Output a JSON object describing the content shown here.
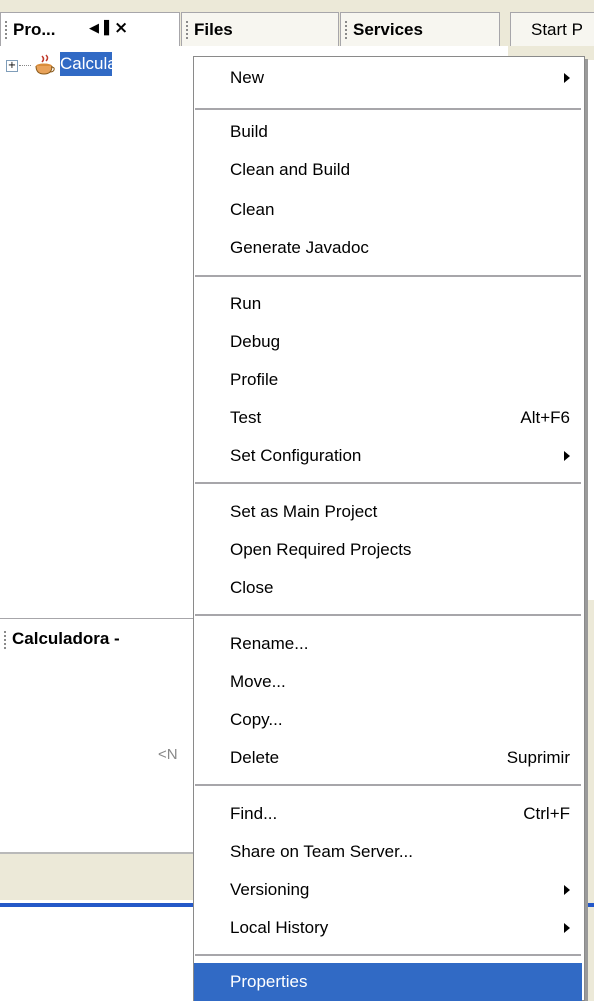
{
  "tabs": {
    "projects": "Pro...",
    "files": "Files",
    "services": "Services",
    "start": "Start P"
  },
  "tree": {
    "expand_glyph": "+",
    "project_label": "Calculadora"
  },
  "navigator": {
    "title": "Calculadora -",
    "no_description": "<N"
  },
  "menu": {
    "new": "New",
    "build": "Build",
    "clean_and_build": "Clean and Build",
    "clean": "Clean",
    "generate_javadoc": "Generate Javadoc",
    "run": "Run",
    "debug": "Debug",
    "profile": "Profile",
    "test": "Test",
    "test_shortcut": "Alt+F6",
    "set_configuration": "Set Configuration",
    "set_main": "Set as Main Project",
    "open_required": "Open Required Projects",
    "close": "Close",
    "rename": "Rename...",
    "move": "Move...",
    "copy": "Copy...",
    "delete": "Delete",
    "delete_shortcut": "Suprimir",
    "find": "Find...",
    "find_shortcut": "Ctrl+F",
    "share": "Share on Team Server...",
    "versioning": "Versioning",
    "local_history": "Local History",
    "properties": "Properties"
  },
  "colors": {
    "selection": "#316ac5",
    "chrome": "#ece9d8"
  }
}
